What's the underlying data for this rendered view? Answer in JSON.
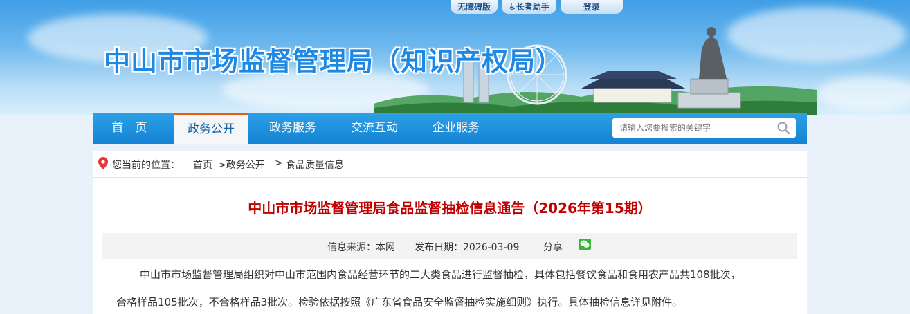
{
  "top_links": {
    "accessibility": "无障碍版",
    "elder": "长者助手",
    "login": "登录"
  },
  "site_title": "中山市市场监督管理局（知识产权局）",
  "nav": {
    "items": [
      "首　页",
      "政务公开",
      "政务服务",
      "交流互动",
      "企业服务"
    ],
    "active_index": 1
  },
  "search": {
    "placeholder": "请输入您要搜索的关键字"
  },
  "breadcrumb": {
    "prefix": "您当前的位置：",
    "items": [
      "首页",
      ">政务公开",
      ">",
      "食品质量信息"
    ]
  },
  "article": {
    "title": "中山市市场监督管理局食品监督抽检信息通告（2026年第15期）",
    "source": "信息来源：本网",
    "date": "发布日期：2026-03-09",
    "share": "分享",
    "para1_line1": "中山市市场监督管理局组织对中山市范围内食品经营环节的二大类食品进行监督抽检，具体包括餐饮食品和食用农产品共108批次，",
    "para1_line2": "合格样品105批次，不合格样品3批次。检验依据按照《广东省食品安全监督抽检实施细则》执行。具体抽检信息详见附件。"
  },
  "colors": {
    "nav_blue": "#1483d3",
    "active_border": "#e8590c",
    "title_red": "#c00000",
    "site_title_blue": "#1e88e5"
  }
}
